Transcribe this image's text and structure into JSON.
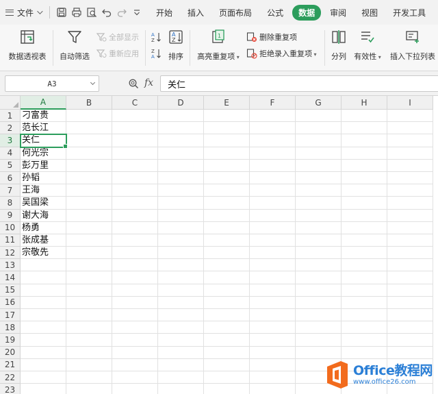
{
  "menubar": {
    "file_label": "文件",
    "quick_access": [
      {
        "icon": "save-icon"
      },
      {
        "icon": "print-icon"
      },
      {
        "icon": "print-preview-icon"
      },
      {
        "icon": "undo-icon"
      },
      {
        "icon": "redo-icon"
      },
      {
        "icon": "more-dropdown-icon"
      }
    ],
    "tabs": [
      {
        "label": "开始",
        "active": false
      },
      {
        "label": "插入",
        "active": false
      },
      {
        "label": "页面布局",
        "active": false
      },
      {
        "label": "公式",
        "active": false
      },
      {
        "label": "数据",
        "active": true
      },
      {
        "label": "审阅",
        "active": false
      },
      {
        "label": "视图",
        "active": false
      },
      {
        "label": "开发工具",
        "active": false
      }
    ]
  },
  "ribbon": {
    "pivot_table": "数据透视表",
    "auto_filter": "自动筛选",
    "show_all": "全部显示",
    "reapply": "重新应用",
    "sort": "排序",
    "highlight_duplicates": "高亮重复项",
    "remove_duplicates": "删除重复项",
    "reject_duplicates": "拒绝录入重复项",
    "text_to_columns": "分列",
    "validation": "有效性",
    "insert_dropdown": "插入下拉列表"
  },
  "formula_bar": {
    "name_box": "A3",
    "fx": "fx",
    "content": "关仁"
  },
  "grid": {
    "columns": [
      "A",
      "B",
      "C",
      "D",
      "E",
      "F",
      "G",
      "H",
      "I"
    ],
    "active_column": "A",
    "active_row": 3,
    "row_count": 23,
    "column_a_values": [
      "刁富贵",
      "范长江",
      "关仁",
      "何光宗",
      "彭万里",
      "孙韬",
      "王海",
      "吴国梁",
      "谢大海",
      "杨勇",
      "张成基",
      "宗敬先"
    ]
  },
  "watermark": {
    "brand": "Office教程网",
    "url": "www.office26.com"
  },
  "colors": {
    "accent": "#2c9d5c",
    "watermark_blue": "#2b7fd6",
    "watermark_orange": "#f26b1d"
  }
}
